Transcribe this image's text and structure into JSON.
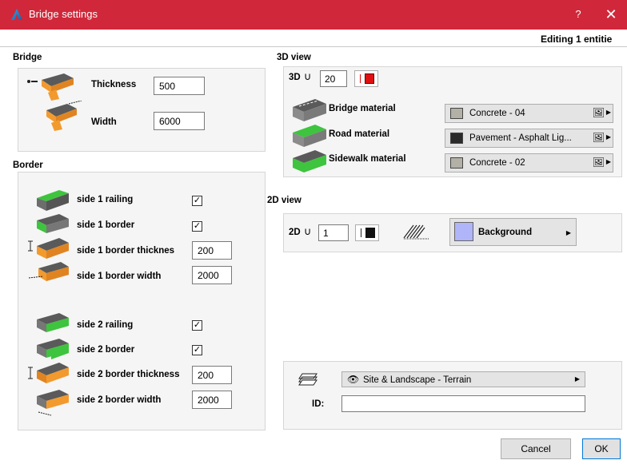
{
  "window": {
    "title": "Bridge settings",
    "help": "?",
    "close": "✕",
    "editing": "Editing 1 entitie"
  },
  "bridge": {
    "title": "Bridge",
    "thickness_label": "Thickness",
    "thickness_value": "500",
    "width_label": "Width",
    "width_value": "6000"
  },
  "border": {
    "title": "Border",
    "side1_railing": "side 1 railing",
    "side1_border": "side 1 border",
    "side1_thickness_label": "side 1 border thicknes",
    "side1_thickness_value": "200",
    "side1_width_label": "side 1 border width",
    "side1_width_value": "2000",
    "side2_railing": "side 2 railing",
    "side2_border": "side 2 border",
    "side2_thickness_label": "side 2 border thickness",
    "side2_thickness_value": "200",
    "side2_width_label": "side 2 border width",
    "side2_width_value": "2000",
    "check_mark": "✓"
  },
  "view3d": {
    "title": "3D view",
    "pen_label": "3D",
    "pen_value": "20",
    "bridge_material_label": "Bridge material",
    "bridge_material": "Concrete - 04",
    "bridge_material_color": "#b3b1a5",
    "road_material_label": "Road material",
    "road_material": "Pavement - Asphalt Lig...",
    "road_material_color": "#2b2b2b",
    "sidewalk_material_label": "Sidewalk material",
    "sidewalk_material": "Concrete - 02",
    "sidewalk_material_color": "#b3b1a5"
  },
  "view2d": {
    "title": "2D view",
    "pen_label": "2D",
    "pen_value": "1",
    "fill": "Background",
    "fill_color": "#b0b4f8"
  },
  "layer": {
    "name": "Site & Landscape - Terrain",
    "id_label": "ID:",
    "id_value": ""
  },
  "buttons": {
    "cancel": "Cancel",
    "ok": "OK"
  },
  "colors": {
    "titlebar": "#d0283a",
    "pen_red": "#e01010",
    "accent_green": "#3ec43e",
    "accent_orange": "#f29a2e"
  }
}
